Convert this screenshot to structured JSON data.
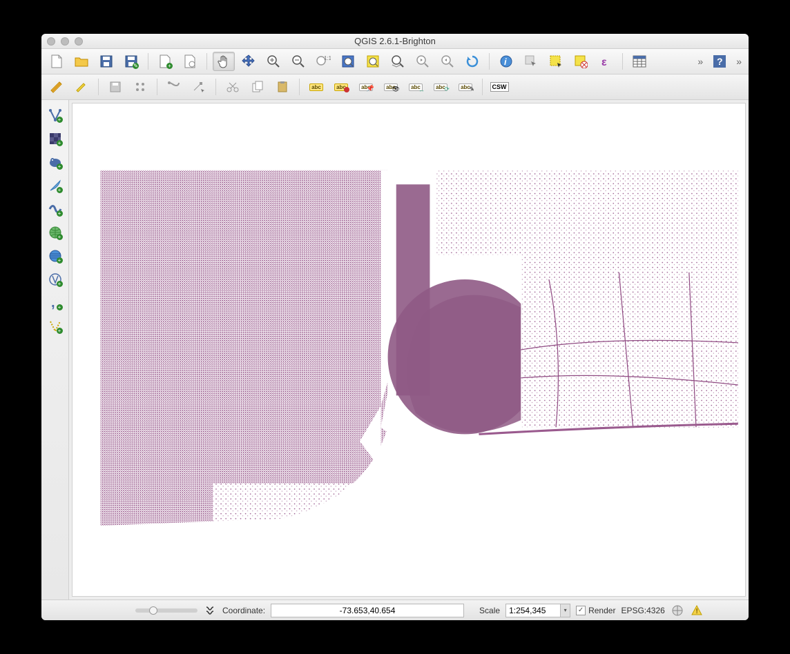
{
  "window": {
    "title": "QGIS 2.6.1-Brighton"
  },
  "status": {
    "coord_label": "Coordinate:",
    "coord_value": "-73.653,40.654",
    "scale_label": "Scale",
    "scale_value": "1:254,345",
    "render_label": "Render",
    "crs_label": "EPSG:4326"
  },
  "toolbar2_labels": {
    "abc": "abc",
    "csw": "CSW"
  }
}
